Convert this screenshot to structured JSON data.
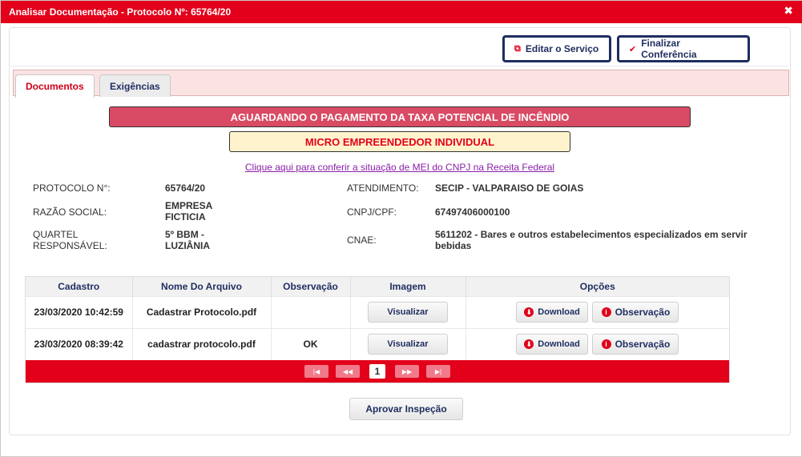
{
  "window": {
    "title": "Analisar Documentação - Protocolo Nº: 65764/20",
    "close_glyph": "✖"
  },
  "toolbar": {
    "edit_label": "Editar o Serviço",
    "finalize_label": "Finalizar Conferência",
    "edit_icon": "external-link-icon",
    "finalize_icon": "check-icon"
  },
  "tabs": [
    {
      "label": "Documentos",
      "active": true
    },
    {
      "label": "Exigências",
      "active": false
    }
  ],
  "banners": {
    "status": "AGUARDANDO O PAGAMENTO DA TAXA POTENCIAL DE INCÊNDIO",
    "category": "MICRO EMPREENDEDOR INDIVIDUAL"
  },
  "mei_link": "Clique aqui para conferir a situação de MEI do CNPJ na Receita Federal",
  "info": {
    "protocolo_label": "PROTOCOLO N°:",
    "protocolo_value": "65764/20",
    "razao_label": "RAZÃO SOCIAL:",
    "razao_value": "EMPRESA FICTICIA",
    "quartel_label": "QUARTEL RESPONSÁVEL:",
    "quartel_value": "5º BBM - LUZIÂNIA",
    "atendimento_label": "ATENDIMENTO:",
    "atendimento_value": "SECIP - VALPARAISO DE GOIAS",
    "cnpj_label": "CNPJ/CPF:",
    "cnpj_value": "67497406000100",
    "cnae_label": "CNAE:",
    "cnae_value": "5611202 - Bares e outros estabelecimentos especializados em servir bebidas"
  },
  "grid": {
    "headers": [
      "Cadastro",
      "Nome Do Arquivo",
      "Observação",
      "Imagem",
      "Opções"
    ],
    "rows": [
      {
        "cadastro": "23/03/2020 10:42:59",
        "arquivo": "Cadastrar Protocolo.pdf",
        "observacao": "",
        "imagem_label": "Visualizar",
        "download_label": "Download",
        "obs_label": "Observação"
      },
      {
        "cadastro": "23/03/2020 08:39:42",
        "arquivo": "cadastrar protocolo.pdf",
        "observacao": "OK",
        "imagem_label": "Visualizar",
        "download_label": "Download",
        "obs_label": "Observação"
      }
    ],
    "pager": {
      "first": "|◀",
      "prev": "◀◀",
      "current": "1",
      "next": "▶▶",
      "last": "▶|"
    }
  },
  "approve_label": "Aprovar Inspeção",
  "colors": {
    "brand_red": "#e2001a",
    "navy": "#1d2d5f",
    "status_banner": "#d94a64",
    "category_banner": "#fff3cd"
  }
}
